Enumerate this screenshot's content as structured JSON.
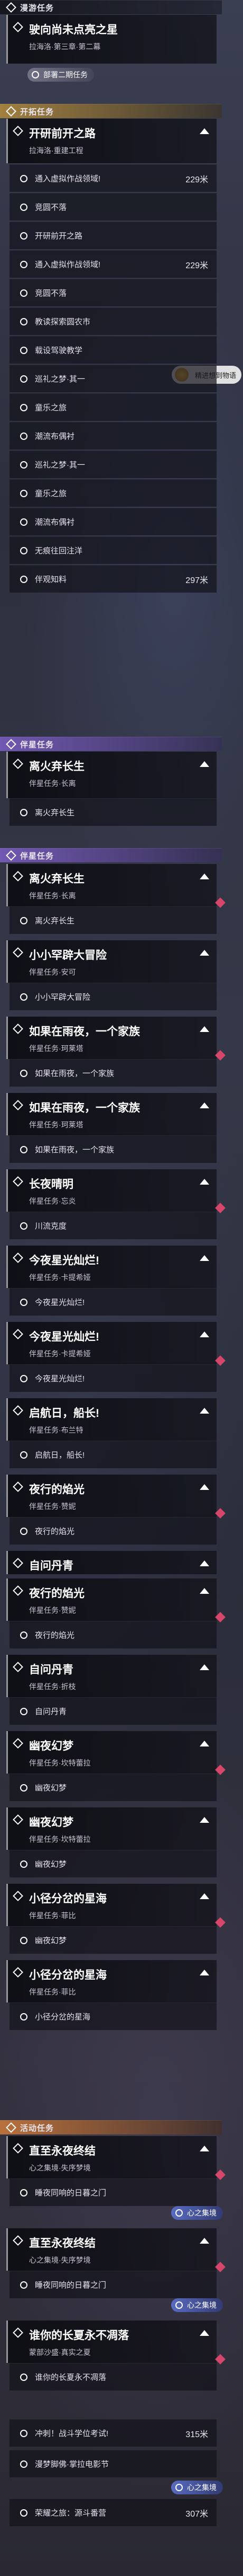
{
  "top_section": {
    "title": "漫游任务"
  },
  "top_quest": {
    "title": "驶向尚未点亮之星",
    "subtitle": "拉海洛·第三章·第二幕"
  },
  "top_tag": {
    "label": "部署二期任务"
  },
  "mission_section": {
    "title": "开拓任务"
  },
  "trailblaze": {
    "title": "开研前开之路",
    "subtitle": "拉海洛·重建工程",
    "steps": [
      {
        "label": "通入虚拟作战领域!",
        "distance": "229米"
      },
      {
        "label": "竞圆不落",
        "distance": ""
      },
      {
        "label": "开研前开之路",
        "distance": ""
      },
      {
        "label": "通入虚拟作战领域!",
        "distance": "229米"
      },
      {
        "label": "竞圆不落",
        "distance": ""
      },
      {
        "label": "教读探索圆农市",
        "distance": ""
      },
      {
        "label": "载设驾驶教学",
        "distance": ""
      },
      {
        "label": "巡礼之梦·其一",
        "distance": ""
      },
      {
        "label": "童乐之旅",
        "distance": ""
      },
      {
        "label": "潮流布偶衬",
        "distance": ""
      },
      {
        "label": "巡礼之梦·其一",
        "distance": ""
      },
      {
        "label": "童乐之旅",
        "distance": ""
      },
      {
        "label": "潮流布偶衬",
        "distance": ""
      },
      {
        "label": "无痕往回注洋",
        "distance": ""
      },
      {
        "label": "伴观知料",
        "distance": "297米"
      }
    ]
  },
  "side_badge": {
    "label": "精进想到物语"
  },
  "companion_a": {
    "title": "伴星任务"
  },
  "companion_a_quest": {
    "title": "离火弃长生",
    "subtitle": "伴星任务·长离",
    "steps": [
      {
        "label": "离火弃长生"
      }
    ]
  },
  "companion_b": {
    "title": "伴星任务"
  },
  "companion_list": [
    {
      "title": "离火弃长生",
      "subtitle": "伴星任务·长离",
      "step": "离火弃长生"
    },
    {
      "title": "小小罕辟大冒险",
      "subtitle": "伴星任务·安可",
      "step": "小小罕辟大冒险"
    },
    {
      "title": "如果在雨夜，一个家族",
      "subtitle": "伴星任务·珂莱塔",
      "step": "如果在雨夜，一个家族"
    },
    {
      "title": "如果在雨夜，一个家族",
      "subtitle": "伴星任务·珂莱塔",
      "step": "如果在雨夜，一个家族"
    },
    {
      "title": "长夜晴明",
      "subtitle": "伴星任务·忘炎",
      "step": "川流克度"
    },
    {
      "title": "今夜星光灿烂!",
      "subtitle": "伴星任务·卡提希娅",
      "step": "今夜星光灿烂!"
    },
    {
      "title": "今夜星光灿烂!",
      "subtitle": "伴星任务·卡提希娅",
      "step": "今夜星光灿烂!"
    },
    {
      "title": "启航日，船长!",
      "subtitle": "伴星任务·布兰特",
      "step": "启航日，船长!"
    },
    {
      "title": "夜行的焰光",
      "subtitle": "伴星任务·赞妮",
      "step": "夜行的焰光"
    },
    {
      "title": "自问丹青",
      "subtitle": "",
      "step": ""
    },
    {
      "title": "夜行的焰光",
      "subtitle": "伴星任务·赞妮",
      "step": "夜行的焰光"
    },
    {
      "title": "自问丹青",
      "subtitle": "伴星任务·折枝",
      "step": "自问丹青"
    },
    {
      "title": "幽夜幻梦",
      "subtitle": "伴星任务·坎特蕾拉",
      "step": "幽夜幻梦"
    },
    {
      "title": "幽夜幻梦",
      "subtitle": "伴星任务·坎特蕾拉",
      "step": "幽夜幻梦"
    },
    {
      "title": "小径分岔的星海",
      "subtitle": "伴星任务·菲比",
      "step": "幽夜幻梦"
    },
    {
      "title": "小径分岔的星海",
      "subtitle": "伴星任务·菲比",
      "step": "小径分岔的星海"
    }
  ],
  "activity_section": {
    "title": "活动任务"
  },
  "activity_list": [
    {
      "title": "直至永夜终结",
      "subtitle": "心之集境·失序梦境",
      "step": "睡夜同响的日暮之门",
      "tag": "心之集境"
    },
    {
      "title": "直至永夜终结",
      "subtitle": "心之集境·失序梦境",
      "step": "睡夜同响的日暮之门",
      "tag": "心之集境"
    },
    {
      "title": "谁你的长夏永不凋落",
      "subtitle": "蒙部沙盛·真实之夏",
      "step": "谁你的长夏永不凋落",
      "tag": ""
    }
  ],
  "tail_steps": [
    {
      "label": "冲刺！战斗学位考试!",
      "distance": "315米"
    },
    {
      "label": "漫梦脚佛·掌拉电影节",
      "distance": ""
    },
    {
      "label": "荣耀之旅：源斗番营",
      "distance": "307米"
    }
  ],
  "tail_tag": {
    "label": "心之集境"
  }
}
